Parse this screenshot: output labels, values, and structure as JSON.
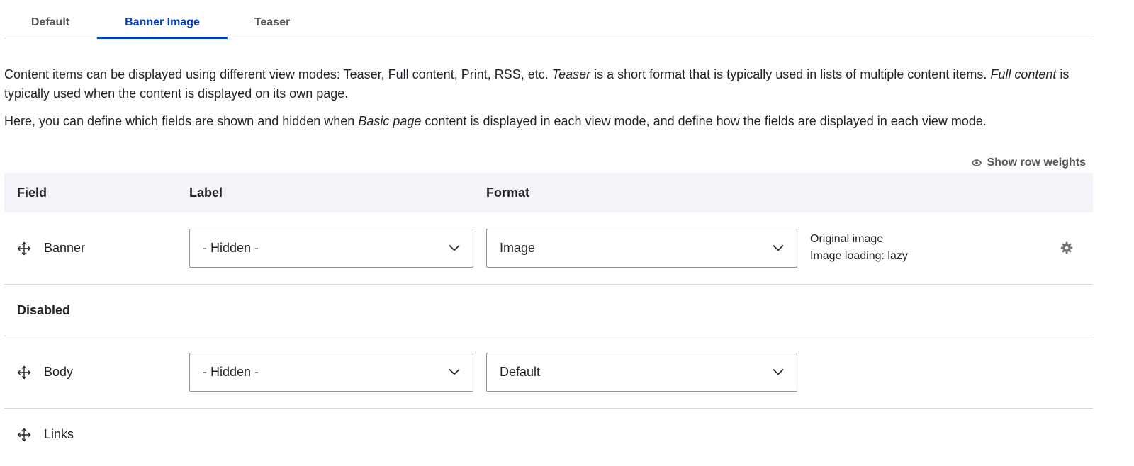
{
  "tabs": [
    {
      "label": "Default",
      "active": false
    },
    {
      "label": "Banner Image",
      "active": true
    },
    {
      "label": "Teaser",
      "active": false
    }
  ],
  "description": {
    "p1_text1": "Content items can be displayed using different view modes: Teaser, Full content, Print, RSS, etc. ",
    "p1_em1": "Teaser",
    "p1_text2": " is a short format that is typically used in lists of multiple content items. ",
    "p1_em2": "Full content",
    "p1_text3": " is typically used when the content is displayed on its own page.",
    "p2_text1": "Here, you can define which fields are shown and hidden when ",
    "p2_em": "Basic page",
    "p2_text2": " content is displayed in each view mode, and define how the fields are displayed in each view mode."
  },
  "row_weights": {
    "label": "Show row weights",
    "icon": "eye-icon"
  },
  "table": {
    "headers": {
      "field": "Field",
      "label": "Label",
      "format": "Format"
    },
    "rows": [
      {
        "field": "Banner",
        "label_select": "- Hidden -",
        "format_select": "Image",
        "summary": [
          "Original image",
          "Image loading: lazy"
        ],
        "has_settings": true
      }
    ],
    "disabled_region": {
      "title": "Disabled",
      "rows": [
        {
          "field": "Body",
          "label_select": "- Hidden -",
          "format_select": "Default"
        },
        {
          "field": "Links"
        }
      ]
    }
  },
  "colors": {
    "accent": "#003ecc",
    "header_bg": "#f3f4f9",
    "border": "#d3d4d9",
    "text": "#232429",
    "muted": "#55565b"
  }
}
